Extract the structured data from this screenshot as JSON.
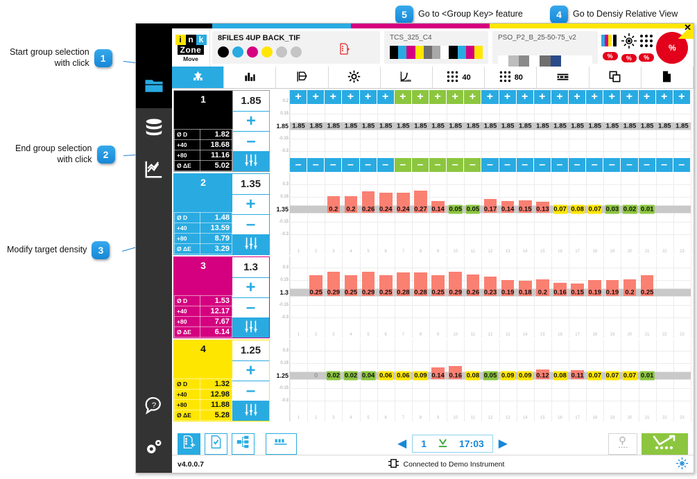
{
  "annotations": [
    {
      "num": "1",
      "text": "Start group selection\nwith click"
    },
    {
      "num": "2",
      "text": "End group selection\nwith click"
    },
    {
      "num": "3",
      "text": "Modify target density"
    },
    {
      "num": "4",
      "text": "Go to Densiy Relative View"
    },
    {
      "num": "5",
      "text": "Go to <Group Key> feature"
    }
  ],
  "window": {
    "close_label": "✕"
  },
  "logo": {
    "letters": [
      "i",
      "n",
      "k",
      ""
    ],
    "zone": "Zone",
    "move": "Move"
  },
  "header": {
    "job_title": "8FILES 4UP BACK_TIF",
    "ink_dots": [
      "#000000",
      "#29abe2",
      "#d4007f",
      "#ffe600",
      "#c4c4c4",
      "#c4c4c4"
    ],
    "curve_name": "TCS_325_C4",
    "strip_name": "PSO_P2_B_25-50-75_v2",
    "pct_items": [
      {
        "icon": "cmyk-bars-icon",
        "badge": "%"
      },
      {
        "icon": "registration-target-icon",
        "badge": "%"
      },
      {
        "icon": "screen-dots-icon",
        "badge": "%"
      }
    ],
    "big_pct": "%"
  },
  "rail": {
    "items": [
      {
        "name": "folder-icon",
        "active": true
      },
      {
        "name": "database-icon",
        "active": false
      },
      {
        "name": "chart-icon",
        "active": false
      }
    ],
    "bottom": [
      {
        "name": "help-icon"
      },
      {
        "name": "settings-icon"
      }
    ]
  },
  "tabs": [
    {
      "id": "tab-zones",
      "icon": "ink-keys-icon",
      "label": "",
      "active": true
    },
    {
      "id": "tab-bars",
      "icon": "bar-chart-icon",
      "label": "",
      "active": false
    },
    {
      "id": "tab-press",
      "icon": "press-icon",
      "label": "",
      "active": false
    },
    {
      "id": "tab-registration",
      "icon": "registration-icon",
      "label": "",
      "active": false
    },
    {
      "id": "tab-curve",
      "icon": "curve-icon",
      "label": "",
      "active": false
    },
    {
      "id": "tab-40",
      "icon": "screen-dots-icon",
      "label": "40",
      "active": false
    },
    {
      "id": "tab-80",
      "icon": "screen-dots-icon",
      "label": "80",
      "active": false
    },
    {
      "id": "tab-slur",
      "icon": "slur-icon",
      "label": "",
      "active": false
    },
    {
      "id": "tab-copy",
      "icon": "copy-icon",
      "label": "",
      "active": false
    },
    {
      "id": "tab-page",
      "icon": "page-icon",
      "label": "",
      "active": false
    }
  ],
  "zones": [
    {
      "number": "1",
      "target": "1.85",
      "color": "#000000",
      "theme": "z1",
      "rows": [
        {
          "label": "Ø D",
          "value": "1.82"
        },
        {
          "label": "+40",
          "value": "18.68"
        },
        {
          "label": "+80",
          "value": "11.16"
        },
        {
          "label": "Ø ΔE",
          "value": "5.02"
        }
      ],
      "plus": "+",
      "minus": "–"
    },
    {
      "number": "2",
      "target": "1.35",
      "color": "#29abe2",
      "theme": "z2",
      "rows": [
        {
          "label": "Ø D",
          "value": "1.48"
        },
        {
          "label": "+40",
          "value": "13.59"
        },
        {
          "label": "+80",
          "value": "8.79"
        },
        {
          "label": "Ø ΔE",
          "value": "3.29"
        }
      ],
      "plus": "+",
      "minus": "–"
    },
    {
      "number": "3",
      "target": "1.3",
      "color": "#d4007f",
      "theme": "z3",
      "rows": [
        {
          "label": "Ø D",
          "value": "1.53"
        },
        {
          "label": "+40",
          "value": "12.17"
        },
        {
          "label": "+80",
          "value": "7.67"
        },
        {
          "label": "Ø ΔE",
          "value": "6.14"
        }
      ],
      "plus": "+",
      "minus": "–"
    },
    {
      "number": "4",
      "target": "1.25",
      "color": "#ffe600",
      "theme": "z4",
      "rows": [
        {
          "label": "Ø D",
          "value": "1.32"
        },
        {
          "label": "+40",
          "value": "12.98"
        },
        {
          "label": "+80",
          "value": "11.88"
        },
        {
          "label": "Ø ΔE",
          "value": "5.28"
        }
      ],
      "plus": "+",
      "minus": "–"
    }
  ],
  "chart_data": [
    {
      "type": "bar",
      "title": "Black (K) zone deviation",
      "center": "1.85",
      "yticks": [
        "0.2",
        "0.15",
        "1.85",
        "-0.15",
        "-0.3"
      ],
      "ylim": [
        -0.3,
        0.3
      ],
      "categories": [
        "1",
        "2",
        "3",
        "4",
        "5",
        "6",
        "7",
        "8",
        "9",
        "10",
        "11",
        "12",
        "13",
        "14",
        "15",
        "16",
        "17",
        "18",
        "19",
        "20",
        "21",
        "22",
        "23"
      ],
      "values": [
        0,
        0,
        0,
        0,
        0,
        0,
        0,
        0,
        0,
        0,
        0,
        0,
        0,
        0,
        0,
        0,
        0,
        0,
        0,
        0,
        0,
        0,
        0
      ],
      "labels": [
        "1.85",
        "1.85",
        "1.85",
        "1.85",
        "1.85",
        "1.85",
        "1.85",
        "1.85",
        "1.85",
        "1.85",
        "1.85",
        "1.85",
        "1.85",
        "1.85",
        "1.85",
        "1.85",
        "1.85",
        "1.85",
        "1.85",
        "1.85",
        "1.85",
        "1.85",
        "1.85"
      ],
      "plus_row": [
        "blue",
        "blue",
        "blue",
        "blue",
        "blue",
        "blue",
        "green",
        "green",
        "green",
        "green",
        "green",
        "blue",
        "blue",
        "blue",
        "blue",
        "blue",
        "blue",
        "blue",
        "blue",
        "blue",
        "blue",
        "blue",
        "blue"
      ],
      "minus_row": [
        "blue",
        "blue",
        "blue",
        "blue",
        "blue",
        "blue",
        "green",
        "green",
        "green",
        "green",
        "green",
        "blue",
        "blue",
        "blue",
        "blue",
        "blue",
        "blue",
        "blue",
        "blue",
        "blue",
        "blue",
        "blue",
        "blue"
      ],
      "plus_symbol": "+",
      "minus_symbol": "–"
    },
    {
      "type": "bar",
      "title": "Cyan (C) zone deviation",
      "center": "1.35",
      "yticks": [
        "0.3",
        "0.15",
        "1.35",
        "-0.15",
        "-0.3"
      ],
      "ylim": [
        -0.3,
        0.3
      ],
      "categories": [
        "1",
        "2",
        "3",
        "4",
        "5",
        "6",
        "7",
        "8",
        "9",
        "10",
        "11",
        "12",
        "13",
        "14",
        "15",
        "16",
        "17",
        "18",
        "19",
        "20",
        "21",
        "22",
        "23"
      ],
      "values": [
        null,
        null,
        0.2,
        0.2,
        0.26,
        0.24,
        0.24,
        0.27,
        0.14,
        0.05,
        0.05,
        0.17,
        0.14,
        0.15,
        0.13,
        0.07,
        0.08,
        0.07,
        0.03,
        0.02,
        0.01,
        null,
        null
      ],
      "labels": [
        "",
        "",
        "0.2",
        "0.2",
        "0.26",
        "0.24",
        "0.24",
        "0.27",
        "0.14",
        "0.05",
        "0.05",
        "0.17",
        "0.14",
        "0.15",
        "0.13",
        "0.07",
        "0.08",
        "0.07",
        "0.03",
        "0.02",
        "0.01",
        "",
        ""
      ],
      "bar_colors": [
        "",
        "",
        "#fa8072",
        "#fa8072",
        "#fa8072",
        "#fa8072",
        "#fa8072",
        "#fa8072",
        "#fa8072",
        "#8cc63f",
        "#8cc63f",
        "#fa8072",
        "#fa8072",
        "#fa8072",
        "#fa8072",
        "#ffe600",
        "#ffe600",
        "#ffe600",
        "#8cc63f",
        "#8cc63f",
        "#8cc63f",
        "",
        ""
      ]
    },
    {
      "type": "bar",
      "title": "Magenta (M) zone deviation",
      "center": "1.3",
      "yticks": [
        "0.3",
        "0.15",
        "1.3",
        "-0.15",
        "-0.3"
      ],
      "ylim": [
        -0.3,
        0.3
      ],
      "categories": [
        "1",
        "2",
        "3",
        "4",
        "5",
        "6",
        "7",
        "8",
        "9",
        "10",
        "11",
        "12",
        "13",
        "14",
        "15",
        "16",
        "17",
        "18",
        "19",
        "20",
        "21",
        "22",
        "23"
      ],
      "values": [
        null,
        0.25,
        0.29,
        0.25,
        0.29,
        0.25,
        0.28,
        0.28,
        0.25,
        0.29,
        0.26,
        0.23,
        0.19,
        0.18,
        0.2,
        0.16,
        0.15,
        0.19,
        0.19,
        0.2,
        0.25,
        null,
        null
      ],
      "labels": [
        "",
        "0.25",
        "0.29",
        "0.25",
        "0.29",
        "0.25",
        "0.28",
        "0.28",
        "0.25",
        "0.29",
        "0.26",
        "0.23",
        "0.19",
        "0.18",
        "0.2",
        "0.16",
        "0.15",
        "0.19",
        "0.19",
        "0.2",
        "0.25",
        "",
        ""
      ],
      "bar_colors": [
        "",
        "#fa8072",
        "#fa8072",
        "#fa8072",
        "#fa8072",
        "#fa8072",
        "#fa8072",
        "#fa8072",
        "#fa8072",
        "#fa8072",
        "#fa8072",
        "#fa8072",
        "#fa8072",
        "#fa8072",
        "#fa8072",
        "#fa8072",
        "#fa8072",
        "#fa8072",
        "#fa8072",
        "#fa8072",
        "#fa8072",
        "",
        ""
      ]
    },
    {
      "type": "bar",
      "title": "Yellow (Y) zone deviation",
      "center": "1.25",
      "yticks": [
        "0.3",
        "0.15",
        "1.25",
        "-0.15",
        "-0.3"
      ],
      "ylim": [
        -0.3,
        0.3
      ],
      "categories": [
        "1",
        "2",
        "3",
        "4",
        "5",
        "6",
        "7",
        "8",
        "9",
        "10",
        "11",
        "12",
        "13",
        "14",
        "15",
        "16",
        "17",
        "18",
        "19",
        "20",
        "21",
        "22",
        "23"
      ],
      "values": [
        null,
        0,
        0.02,
        0.02,
        0.04,
        0.06,
        0.06,
        0.09,
        0.14,
        0.16,
        0.08,
        0.05,
        0.09,
        0.09,
        0.12,
        0.08,
        0.11,
        0.07,
        0.07,
        0.07,
        0.01,
        null,
        null
      ],
      "labels": [
        "",
        "0",
        "0.02",
        "0.02",
        "0.04",
        "0.06",
        "0.06",
        "0.09",
        "0.14",
        "0.16",
        "0.08",
        "0.05",
        "0.09",
        "0.09",
        "0.12",
        "0.08",
        "0.11",
        "0.07",
        "0.07",
        "0.07",
        "0.01",
        "",
        ""
      ],
      "bar_colors": [
        "",
        "#cccccc",
        "#8cc63f",
        "#8cc63f",
        "#8cc63f",
        "#ffe600",
        "#ffe600",
        "#ffe600",
        "#fa8072",
        "#fa8072",
        "#ffe600",
        "#8cc63f",
        "#ffe600",
        "#ffe600",
        "#fa8072",
        "#ffe600",
        "#fa8072",
        "#ffe600",
        "#ffe600",
        "#ffe600",
        "#8cc63f",
        "",
        ""
      ]
    }
  ],
  "footer": {
    "buttons": [
      {
        "id": "export-button",
        "icon": "export-doc-icon",
        "active": true
      },
      {
        "id": "validate-button",
        "icon": "check-doc-icon",
        "active": false
      },
      {
        "id": "split-button",
        "icon": "split-node-icon",
        "active": false
      },
      {
        "id": "strip-button",
        "icon": "strip-icon",
        "active": false
      }
    ],
    "prev": "◀",
    "next": "▶",
    "page": "1",
    "sheet_icon": "download-sheet-icon",
    "time": "17:03",
    "lamp_icon": "lamp-icon",
    "measure_icon": "measure-curve-icon"
  },
  "status": {
    "version": "v4.0.0.7",
    "connection": "Connected to Demo Instrument",
    "target_icon": "registration-target-icon"
  }
}
